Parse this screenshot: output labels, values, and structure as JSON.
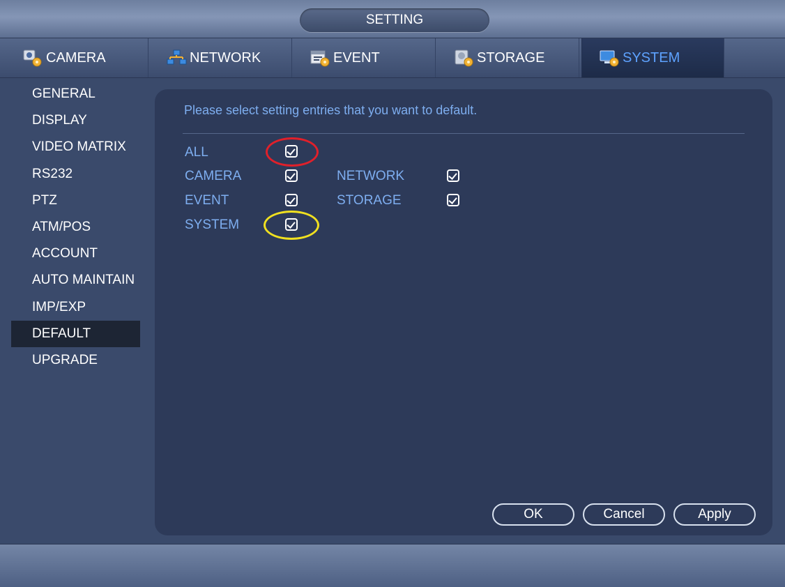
{
  "window": {
    "title": "SETTING"
  },
  "tabs": [
    {
      "label": "CAMERA",
      "icon": "camera-settings-icon",
      "active": false
    },
    {
      "label": "NETWORK",
      "icon": "network-settings-icon",
      "active": false
    },
    {
      "label": "EVENT",
      "icon": "event-settings-icon",
      "active": false
    },
    {
      "label": "STORAGE",
      "icon": "storage-settings-icon",
      "active": false
    },
    {
      "label": "SYSTEM",
      "icon": "system-settings-icon",
      "active": true
    }
  ],
  "sidebar": {
    "items": [
      {
        "label": "GENERAL"
      },
      {
        "label": "DISPLAY"
      },
      {
        "label": "VIDEO MATRIX"
      },
      {
        "label": "RS232"
      },
      {
        "label": "PTZ"
      },
      {
        "label": "ATM/POS"
      },
      {
        "label": "ACCOUNT"
      },
      {
        "label": "AUTO MAINTAIN"
      },
      {
        "label": "IMP/EXP"
      },
      {
        "label": "DEFAULT"
      },
      {
        "label": "UPGRADE"
      }
    ],
    "active_index": 9
  },
  "main": {
    "instruction": "Please select setting entries that you want to default.",
    "options": {
      "all": {
        "label": "ALL",
        "checked": true
      },
      "camera": {
        "label": "CAMERA",
        "checked": true
      },
      "network": {
        "label": "NETWORK",
        "checked": true
      },
      "event": {
        "label": "EVENT",
        "checked": true
      },
      "storage": {
        "label": "STORAGE",
        "checked": true
      },
      "system": {
        "label": "SYSTEM",
        "checked": true
      }
    },
    "annotations": {
      "all_highlight_color": "#e0202a",
      "system_highlight_color": "#f0e020"
    },
    "buttons": {
      "ok": "OK",
      "cancel": "Cancel",
      "apply": "Apply"
    }
  },
  "colors": {
    "accent": "#5ea2ff",
    "label": "#7eaef0",
    "panel": "#2d3a59",
    "background": "#3a4a6b"
  }
}
